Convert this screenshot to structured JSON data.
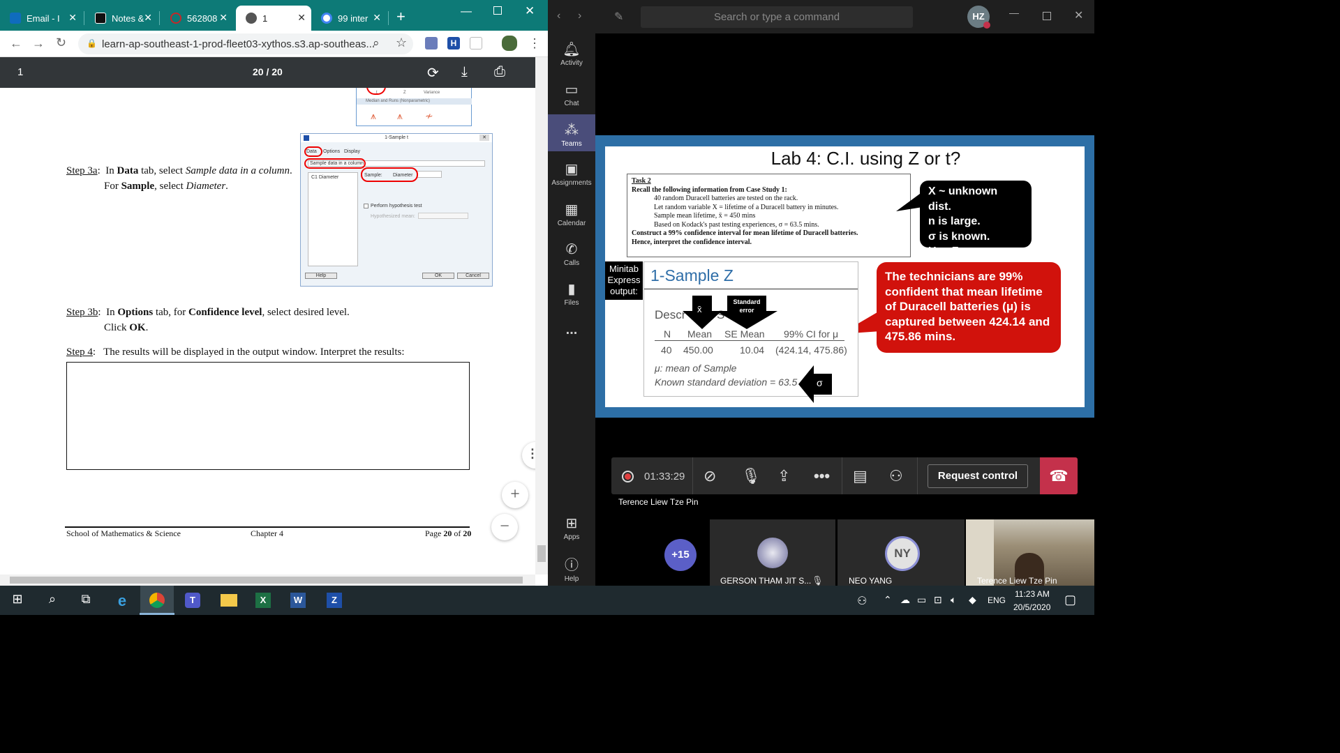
{
  "browser": {
    "tabs": [
      {
        "label": "Email - I",
        "favicon": "outlook-icon",
        "color": "#0f6cbd"
      },
      {
        "label": "Notes &",
        "favicon": "blackboard-icon",
        "color": "#000000"
      },
      {
        "label": "562808",
        "favicon": "blocked-icon",
        "color": "#c62828"
      },
      {
        "label": "1",
        "favicon": "globe-icon",
        "color": "#555555",
        "active": true
      },
      {
        "label": "99 inter",
        "favicon": "google-icon",
        "color": "#4285f4"
      }
    ],
    "url": "learn-ap-southeast-1-prod-fleet03-xythos.s3.ap-southeas...",
    "pdf": {
      "page_input": "1",
      "page_count": "20 / 20"
    }
  },
  "doc": {
    "step3a": {
      "label": "Step 3a",
      "line1_prefix": "In ",
      "line1_bold": "Data",
      "line1_mid": " tab, select ",
      "line1_italic": "Sample data in a column",
      "line1_end": ".",
      "line2_prefix": "For ",
      "line2_bold": "Sample",
      "line2_mid": ", select ",
      "line2_italic": "Diameter",
      "line2_end": "."
    },
    "step3b": {
      "label": "Step 3b",
      "line1_prefix": "In ",
      "line1_bold": "Options",
      "line1_mid": " tab, for ",
      "line1_bold2": "Confidence level",
      "line1_end": ", select desired level.",
      "line2_prefix": "Click ",
      "line2_bold": "OK",
      "line2_end": "."
    },
    "step4": {
      "label": "Step 4",
      "text": "The results will be displayed in the output window.  Interpret the results:"
    },
    "footer": {
      "left": "School of Mathematics & Science",
      "center": "Chapter 4",
      "right_prefix": "Page ",
      "right_page": "20",
      "right_of": " of ",
      "right_total": "20"
    },
    "dialog": {
      "title": "1-Sample t",
      "tabs": [
        "Data",
        "Options",
        "Display"
      ],
      "select": "Sample data in a column",
      "column": "C1  Diameter",
      "sample_label": "Sample:",
      "sample_value": "Diameter",
      "checkbox": "Perform hypothesis test",
      "hyp_mean": "Hypothesized mean:",
      "help": "Help",
      "ok": "OK",
      "cancel": "Cancel"
    },
    "top_fragment": {
      "labels": [
        "t",
        "Z",
        "Variance"
      ],
      "section": "Median and Runs (Nonparametric)"
    }
  },
  "teams": {
    "search_placeholder": "Search or type a command",
    "avatar": "HZ",
    "rail": [
      {
        "label": "Activity",
        "icon": "bell-icon"
      },
      {
        "label": "Chat",
        "icon": "chat-icon"
      },
      {
        "label": "Teams",
        "icon": "teams-icon",
        "active": true
      },
      {
        "label": "Assignments",
        "icon": "assignments-icon"
      },
      {
        "label": "Calendar",
        "icon": "calendar-icon"
      },
      {
        "label": "Calls",
        "icon": "phone-icon"
      },
      {
        "label": "Files",
        "icon": "files-icon"
      },
      {
        "label": "...",
        "icon": "more-icon"
      },
      {
        "label": "Apps",
        "icon": "apps-icon"
      },
      {
        "label": "Help",
        "icon": "help-icon"
      }
    ],
    "slide": {
      "title": "Lab 4: C.I. using Z or t?",
      "task_heading": "Task 2",
      "task_recall": "Recall the following information from Case Study 1:",
      "task_lines": [
        "40 random Duracell batteries are tested on the rack.",
        "Let random variable X = lifetime of a Duracell battery in minutes.",
        "Sample mean lifetime,  x̄ = 450 mins",
        "Based on Kodack's past testing experiences, σ = 63.5 mins."
      ],
      "task_construct": "Construct a 99% confidence interval for mean lifetime of Duracell batteries.",
      "task_interpret": "Hence, interpret the confidence interval.",
      "bubble_lines": [
        "X ~ unknown dist.",
        "n is large.",
        "σ is known.",
        "Use Z."
      ],
      "red_bubble": "The technicians are 99% confident that mean lifetime of Duracell batteries (μ) is captured between 424.14 and 475.86 mins.",
      "minitab_label": "Minitab Express output:",
      "output_title": "1-Sample Z",
      "desc_heading": "Descr",
      "desc_tail": "S",
      "arrow_xbar": "x̄",
      "arrow_se": "Standard error",
      "arrow_sigma": "σ",
      "table_headers": [
        "N",
        "Mean",
        "SE Mean",
        "99% CI for μ"
      ],
      "table_row": [
        "40",
        "450.00",
        "10.04",
        "(424.14, 475.86)"
      ],
      "mu_note": "μ: mean of Sample",
      "known_sd": "Known standard deviation = 63.5"
    },
    "call": {
      "timer": "01:33:29",
      "request_control": "Request control",
      "presenter": "Terence Liew Tze Pin"
    },
    "participants": {
      "more": "+15",
      "p1_name": "GERSON THAM JIT S...",
      "p2_initials": "NY",
      "p2_name": "NEO YANG",
      "p3_name": "Terence Liew Tze Pin"
    }
  },
  "taskbar": {
    "lang": "ENG",
    "time": "11:23 AM",
    "date": "20/5/2020"
  }
}
